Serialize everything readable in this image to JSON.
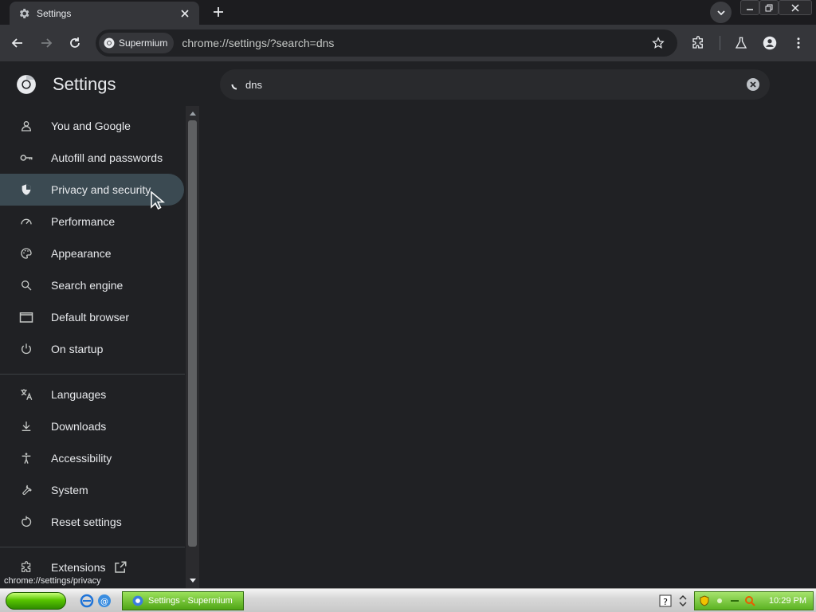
{
  "browser": {
    "tab_title": "Settings",
    "site_chip": "Supermium",
    "url": "chrome://settings/?search=dns"
  },
  "settings": {
    "title": "Settings",
    "search_value": "dns",
    "nav_group1": [
      {
        "label": "You and Google",
        "icon": "person-icon"
      },
      {
        "label": "Autofill and passwords",
        "icon": "key-icon"
      },
      {
        "label": "Privacy and security",
        "icon": "shield-icon"
      },
      {
        "label": "Performance",
        "icon": "speedometer-icon"
      },
      {
        "label": "Appearance",
        "icon": "palette-icon"
      },
      {
        "label": "Search engine",
        "icon": "search-icon"
      },
      {
        "label": "Default browser",
        "icon": "browser-window-icon"
      },
      {
        "label": "On startup",
        "icon": "power-icon"
      }
    ],
    "nav_group2": [
      {
        "label": "Languages",
        "icon": "translate-icon"
      },
      {
        "label": "Downloads",
        "icon": "download-icon"
      },
      {
        "label": "Accessibility",
        "icon": "accessibility-icon"
      },
      {
        "label": "System",
        "icon": "wrench-icon"
      },
      {
        "label": "Reset settings",
        "icon": "reset-icon"
      }
    ],
    "nav_extensions": {
      "label": "Extensions",
      "icon": "puzzle-icon"
    },
    "active_item": "Privacy and security"
  },
  "status_url": "chrome://settings/privacy",
  "taskbar": {
    "task_label": "Settings - Supermium",
    "clock": "10:29 PM"
  },
  "colors": {
    "page_bg": "#202124",
    "toolbar_bg": "#35363a",
    "active_nav_bg": "#3b4a52",
    "taskbar_green": "#58c500"
  }
}
